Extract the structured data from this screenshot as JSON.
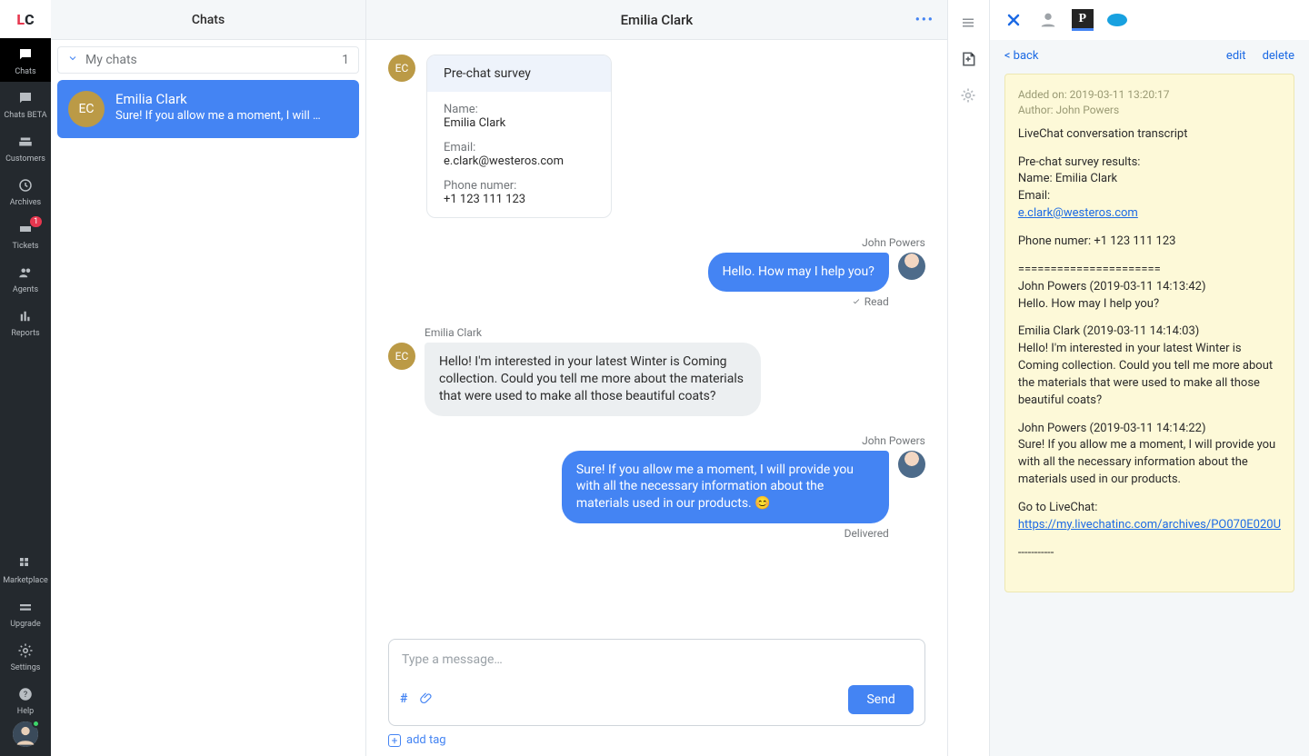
{
  "rail": {
    "items": [
      {
        "id": "chats",
        "label": "Chats",
        "badge": null
      },
      {
        "id": "chats-beta",
        "label": "Chats BETA",
        "badge": null
      },
      {
        "id": "customers",
        "label": "Customers",
        "badge": null
      },
      {
        "id": "archives",
        "label": "Archives",
        "badge": null
      },
      {
        "id": "tickets",
        "label": "Tickets",
        "badge": "1"
      },
      {
        "id": "agents",
        "label": "Agents",
        "badge": null
      },
      {
        "id": "reports",
        "label": "Reports",
        "badge": null
      }
    ],
    "bottom": [
      {
        "id": "marketplace",
        "label": "Marketplace"
      },
      {
        "id": "upgrade",
        "label": "Upgrade"
      },
      {
        "id": "settings",
        "label": "Settings"
      },
      {
        "id": "help",
        "label": "Help"
      }
    ]
  },
  "chatlist": {
    "header": "Chats",
    "filter_label": "My chats",
    "filter_count": "1",
    "items": [
      {
        "initials": "EC",
        "name": "Emilia Clark",
        "preview": "Sure! If you allow me a moment, I will provid…"
      }
    ]
  },
  "conversation": {
    "title": "Emilia Clark",
    "survey": {
      "header": "Pre-chat survey",
      "name_label": "Name:",
      "name_value": "Emilia Clark",
      "email_label": "Email:",
      "email_value": "e.clark@westeros.com",
      "phone_label": "Phone numer:",
      "phone_value": "+1 123 111 123"
    },
    "messages": [
      {
        "side": "out",
        "author": "John Powers",
        "text": "Hello. How may I help you?",
        "status": "Read"
      },
      {
        "side": "in",
        "author": "Emilia Clark",
        "text": "Hello! I'm interested in your latest Winter is Coming collection. Could you tell me more about the materials that were used to make all those beautiful coats?"
      },
      {
        "side": "out",
        "author": "John Powers",
        "text": "Sure! If you allow me a moment, I will provide you with all the necessary information about the materials used in our products. 😊",
        "status": "Delivered"
      }
    ],
    "input_placeholder": "Type a message…",
    "send_label": "Send",
    "add_tag_label": "add tag"
  },
  "detail": {
    "back_label": "< back",
    "edit_label": "edit",
    "delete_label": "delete",
    "note": {
      "added_line": "Added on: 2019-03-11 13:20:17",
      "author_line": "Author: John Powers",
      "l1": "LiveChat conversation transcript",
      "l2": "Pre-chat survey results:",
      "l3": "Name: Emilia Clark",
      "l4": "Email:",
      "l5": "e.clark@westeros.com",
      "l6": "Phone numer: +1 123 111 123",
      "l7": "======================",
      "l8": "John Powers (2019-03-11 14:13:42)",
      "l9": "Hello. How may I help you?",
      "l10": "Emilia Clark (2019-03-11 14:14:03)",
      "l11": "Hello! I'm interested in your latest Winter is Coming collection. Could you tell me more about the materials that were used to make all those beautiful coats?",
      "l12": "John Powers (2019-03-11 14:14:22)",
      "l13": "Sure! If you allow me a moment, I will provide you with all the necessary information about the materials used in our products.",
      "l14": "Go to LiveChat:",
      "l15": "https://my.livechatinc.com/archives/PO070E020U",
      "l16": "-----------"
    }
  }
}
